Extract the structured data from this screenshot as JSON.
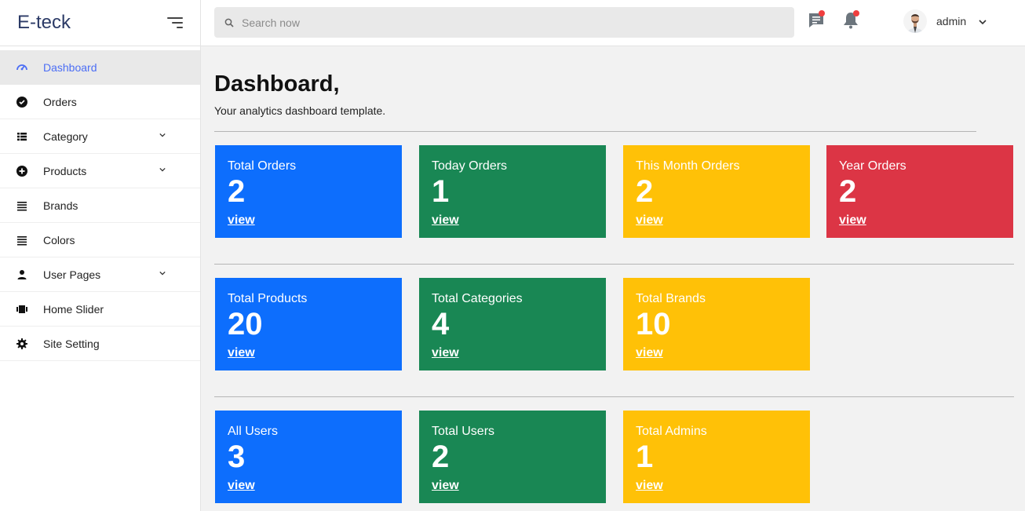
{
  "sidebar": {
    "brand": "E-teck",
    "items": [
      {
        "label": "Dashboard"
      },
      {
        "label": "Orders"
      },
      {
        "label": "Category"
      },
      {
        "label": "Products"
      },
      {
        "label": "Brands"
      },
      {
        "label": "Colors"
      },
      {
        "label": "User Pages"
      },
      {
        "label": "Home Slider"
      },
      {
        "label": "Site Setting"
      }
    ]
  },
  "topbar": {
    "search_placeholder": "Search now",
    "user_name": "admin"
  },
  "main": {
    "title": "Dashboard,",
    "subtitle": "Your analytics dashboard template.",
    "cards": [
      {
        "title": "Total Orders",
        "value": "2",
        "link": "view"
      },
      {
        "title": "Today Orders",
        "value": "1",
        "link": "view"
      },
      {
        "title": "This Month Orders",
        "value": "2",
        "link": "view"
      },
      {
        "title": "Year Orders",
        "value": "2",
        "link": "view"
      },
      {
        "title": "Total Products",
        "value": "20",
        "link": "view"
      },
      {
        "title": "Total Categories",
        "value": "4",
        "link": "view"
      },
      {
        "title": "Total Brands",
        "value": "10",
        "link": "view"
      },
      {
        "title": "All Users",
        "value": "3",
        "link": "view"
      },
      {
        "title": "Total Users",
        "value": "2",
        "link": "view"
      },
      {
        "title": "Total Admins",
        "value": "1",
        "link": "view"
      }
    ]
  },
  "colors": {
    "blue": "#0d6efd",
    "green": "#198754",
    "yellow": "#ffc107",
    "red": "#dc3545",
    "active_nav": "#4c6ef5"
  },
  "icons": [
    "menu-toggle-icon",
    "gauge-icon",
    "orders-icon",
    "list-icon",
    "plus-circle-icon",
    "lines-icon",
    "user-icon",
    "slider-icon",
    "gear-icon",
    "search-icon",
    "chat-icon",
    "bell-icon",
    "chevron-down-icon"
  ]
}
